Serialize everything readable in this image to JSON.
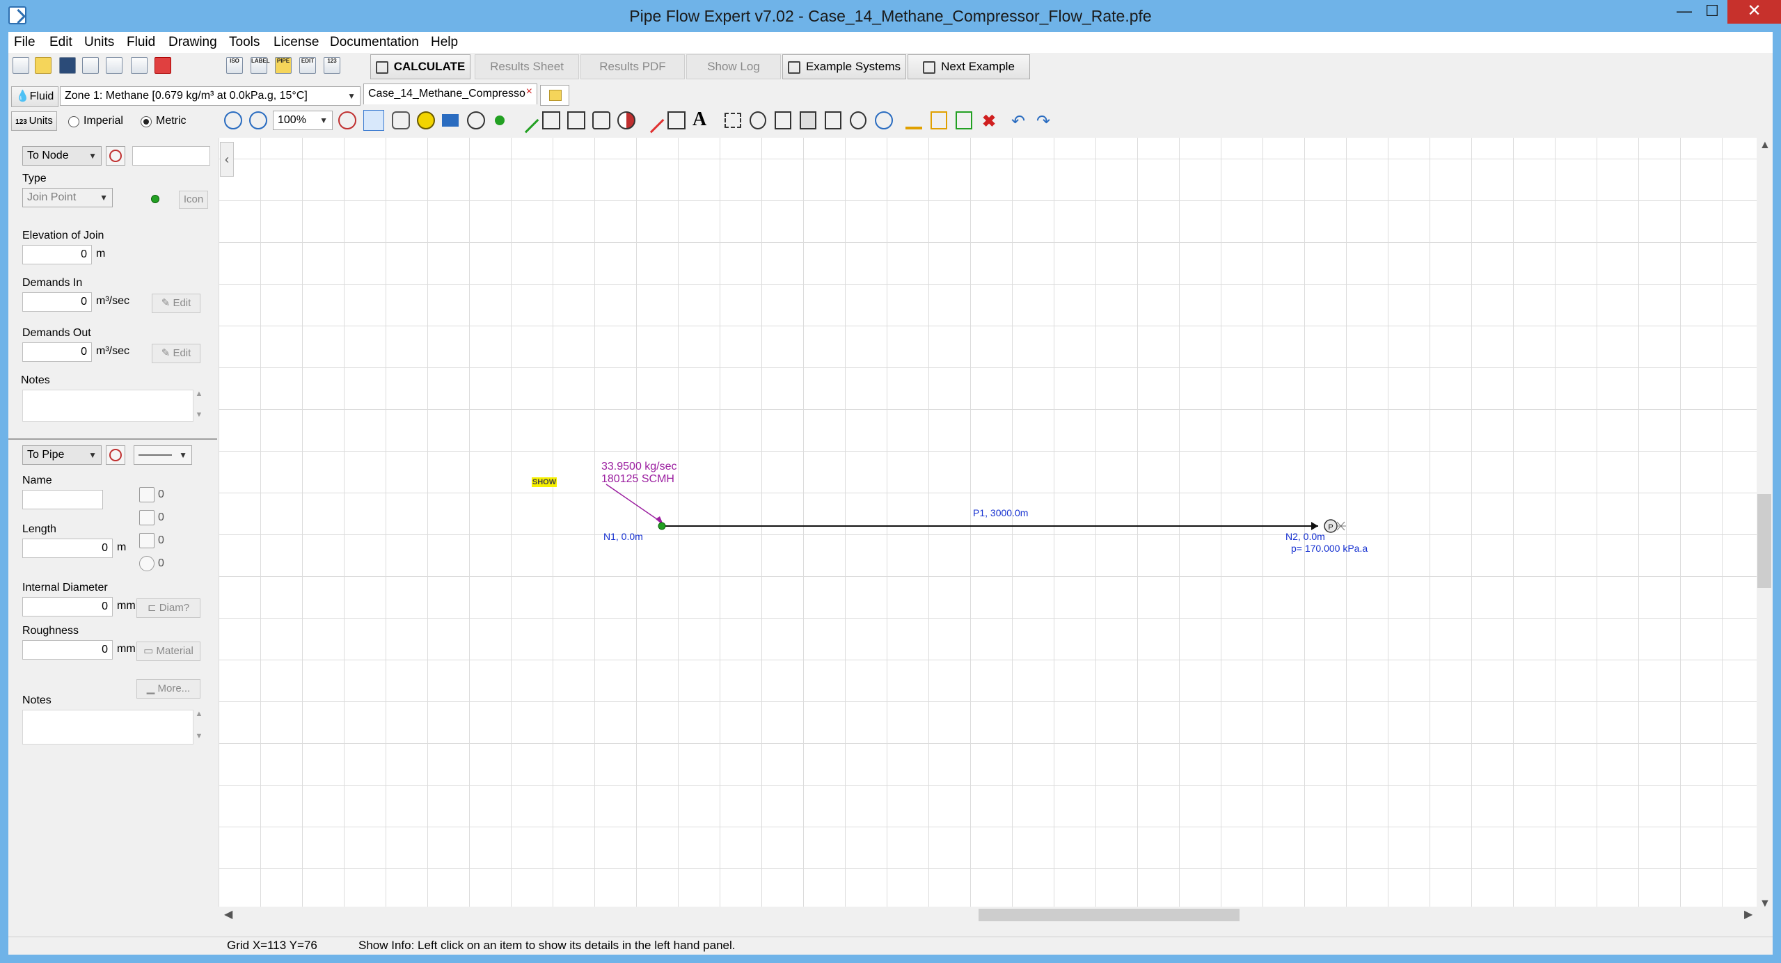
{
  "window": {
    "title": "Pipe Flow Expert v7.02 - Case_14_Methane_Compressor_Flow_Rate.pfe",
    "minimize_glyph": "—",
    "maximize_glyph": "☐",
    "close_glyph": "✕"
  },
  "menu": [
    "File",
    "Edit",
    "Units",
    "Fluid",
    "Drawing",
    "Tools",
    "License",
    "Documentation",
    "Help"
  ],
  "toolbar": {
    "small_icon_labels": [
      "ISO",
      "LABEL",
      "PIPE",
      "EDIT",
      "123"
    ],
    "calculate": "CALCULATE",
    "results_sheet": "Results Sheet",
    "results_pdf": "Results PDF",
    "show_log": "Show Log",
    "example_systems": "Example Systems",
    "next_example": "Next Example"
  },
  "fluid_bar": {
    "fluid_button": "Fluid",
    "fluid_zone": "Zone 1: Methane [0.679 kg/m³ at 0.0kPa.g, 15°C]",
    "tab_name": "Case_14_Methane_Compresso",
    "tab_close": "×"
  },
  "units_bar": {
    "units_button": "Units",
    "imperial": "Imperial",
    "metric": "Metric",
    "selected": "Metric",
    "zoom": "100%",
    "text_tool": "A"
  },
  "node_panel": {
    "selector": "To Node",
    "name_value": "",
    "type_label": "Type",
    "type_value": "Join Point",
    "icon_button": "Icon",
    "elevation_label": "Elevation of Join",
    "elevation_value": "0",
    "elevation_unit": "m",
    "demands_in_label": "Demands In",
    "demands_in_value": "0",
    "demands_in_unit": "m³/sec",
    "demands_out_label": "Demands Out",
    "demands_out_value": "0",
    "demands_out_unit": "m³/sec",
    "edit_button": "Edit",
    "notes_label": "Notes"
  },
  "pipe_panel": {
    "selector": "To Pipe",
    "line_style": "———",
    "name_label": "Name",
    "name_value": "",
    "length_label": "Length",
    "length_value": "0",
    "length_unit": "m",
    "fitting_counts": [
      "0",
      "0",
      "0",
      "0"
    ],
    "diameter_label": "Internal Diameter",
    "diameter_value": "0",
    "diameter_unit": "mm",
    "diameter_button": "Diam?",
    "roughness_label": "Roughness",
    "roughness_value": "0",
    "roughness_unit": "mm",
    "material_button": "Material",
    "more_button": "More...",
    "notes_label": "Notes"
  },
  "diagram": {
    "show_badge": "SHOW",
    "flow_mass": "33.9500 kg/sec",
    "flow_std": "180125 SCMH",
    "node1": "N1, 0.0m",
    "pipe1": "P1, 3000.0m",
    "node2": "N2, 0.0m",
    "node2_pressure": "p= 170.000 kPa.a",
    "pressure_symbol": "P"
  },
  "status": {
    "grid": "Grid  X=113  Y=76",
    "info": "Show Info: Left click on an item to show its details in the left hand panel."
  },
  "colors": {
    "title_bar": "#6fb3e8",
    "close_button": "#c7312c",
    "node_green": "#22a022",
    "flow_label": "#9b1fa0",
    "node_label": "#1530d0"
  }
}
